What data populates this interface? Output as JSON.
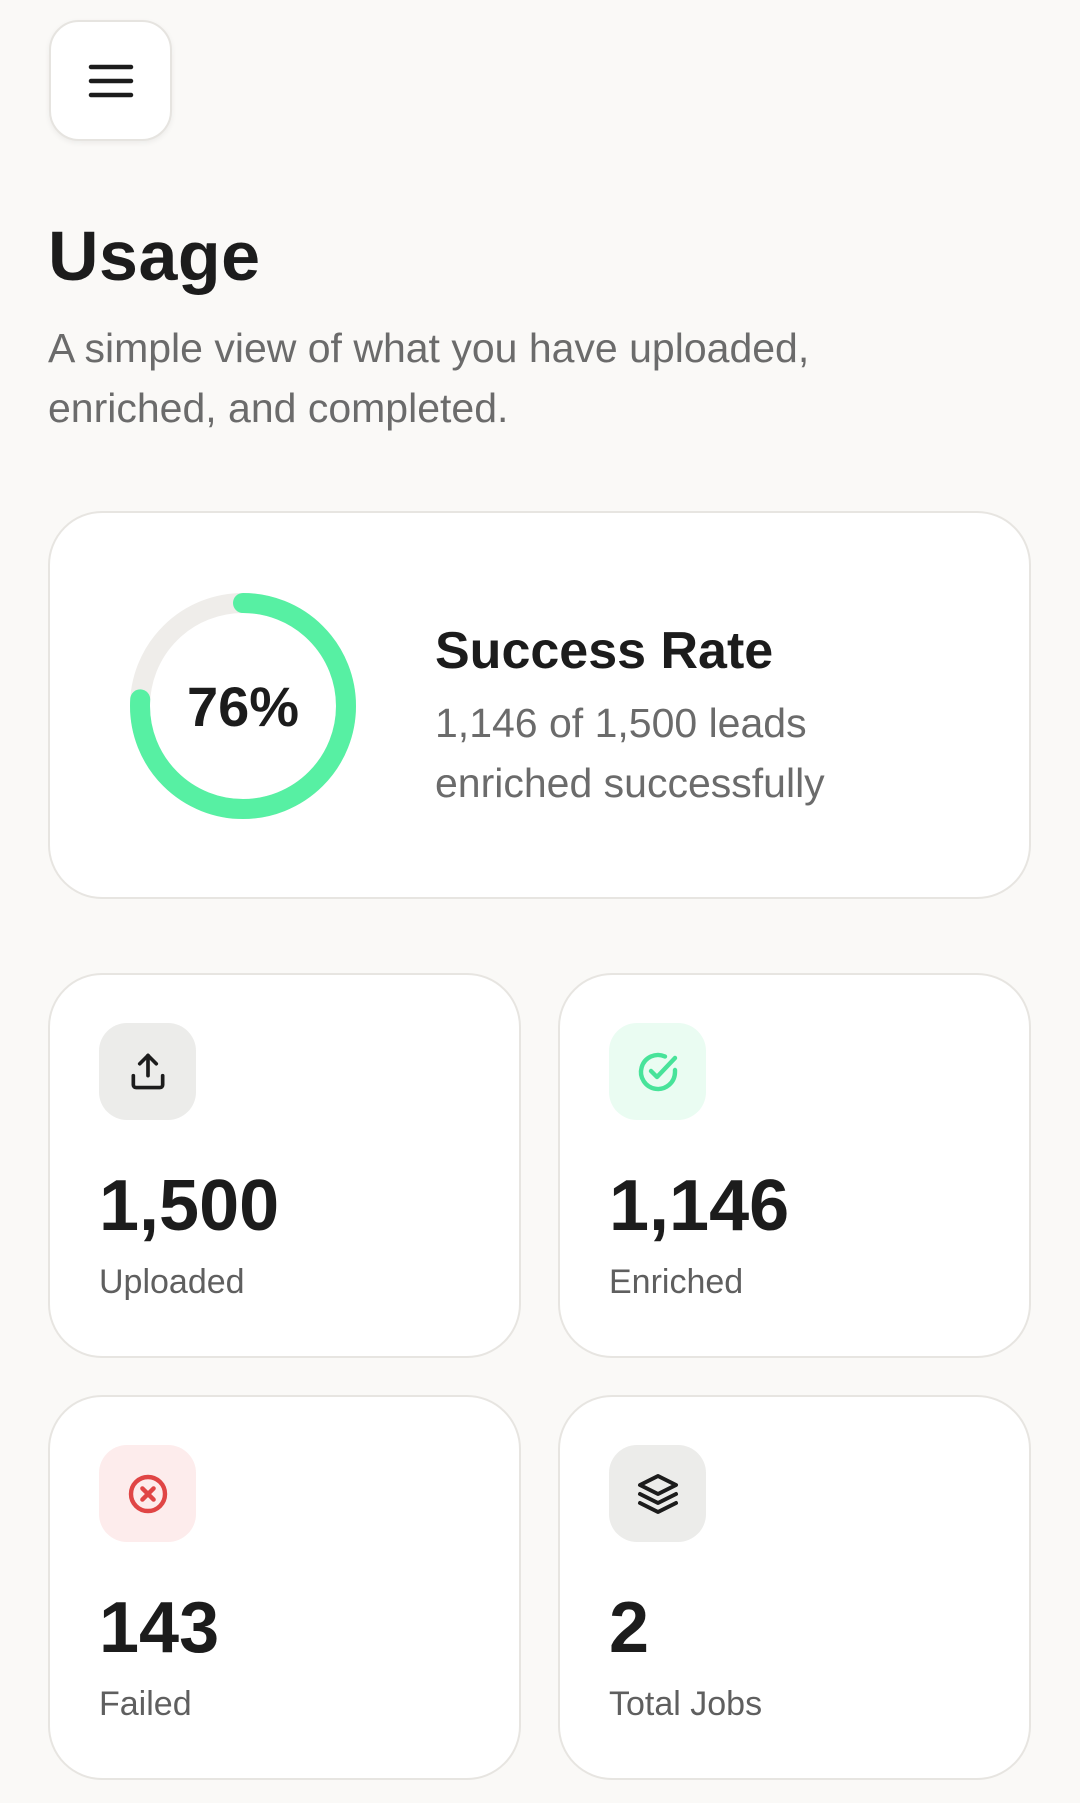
{
  "header": {
    "menu_icon": "hamburger-menu-icon",
    "title": "Usage",
    "subtitle": "A simple view of what you have uploaded, enriched, and completed."
  },
  "success_rate": {
    "percent_label": "76%",
    "percent_value": 76,
    "title": "Success Rate",
    "description": "1,146 of 1,500 leads enriched successfully",
    "ring_color": "#57f0a3",
    "track_color": "#efedea"
  },
  "stats": {
    "uploaded": {
      "value": "1,500",
      "label": "Uploaded",
      "icon": "upload-icon",
      "icon_bg": "#ececea",
      "icon_color": "#1c1c1c"
    },
    "enriched": {
      "value": "1,146",
      "label": "Enriched",
      "icon": "check-circle-icon",
      "icon_bg": "#eafcf2",
      "icon_color": "#48e39a"
    },
    "failed": {
      "value": "143",
      "label": "Failed",
      "icon": "x-circle-icon",
      "icon_bg": "#fdecec",
      "icon_color": "#e04545"
    },
    "total_jobs": {
      "value": "2",
      "label": "Total Jobs",
      "icon": "layers-icon",
      "icon_bg": "#ececea",
      "icon_color": "#1c1c1c"
    }
  }
}
